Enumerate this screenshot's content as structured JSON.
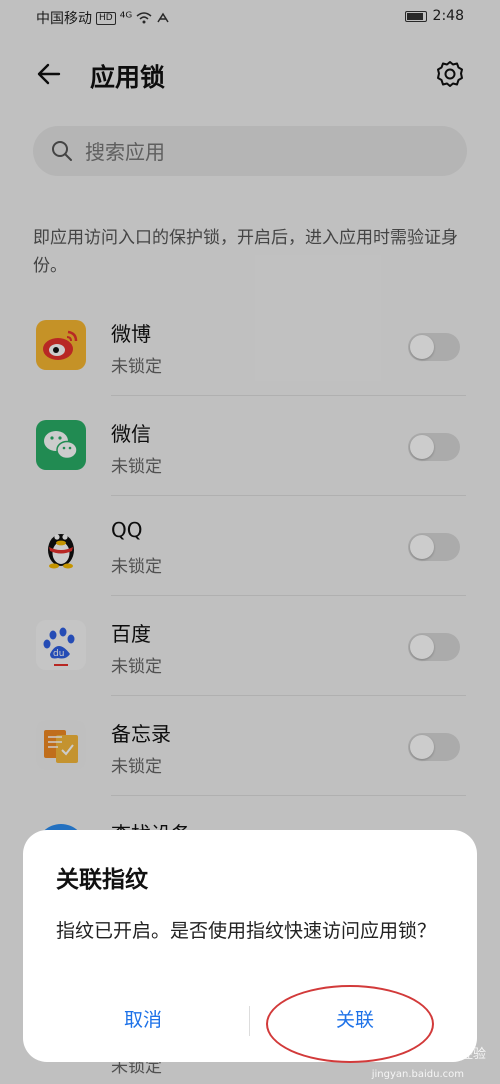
{
  "status_bar": {
    "carrier": "中国移动",
    "hd": "HD",
    "signal": "⁴ᴳ",
    "time": "2:48"
  },
  "header": {
    "title": "应用锁"
  },
  "search": {
    "placeholder": "搜索应用"
  },
  "description": "即应用访问入口的保护锁，开启后，进入应用时需验证身份。",
  "apps": [
    {
      "name": "微博",
      "status": "未锁定",
      "icon": "weibo-icon",
      "locked": false
    },
    {
      "name": "微信",
      "status": "未锁定",
      "icon": "wechat-icon",
      "locked": false
    },
    {
      "name": "QQ",
      "status": "未锁定",
      "icon": "qq-icon",
      "locked": false
    },
    {
      "name": "百度",
      "status": "未锁定",
      "icon": "baidu-icon",
      "locked": false
    },
    {
      "name": "备忘录",
      "status": "未锁定",
      "icon": "notepad-icon",
      "locked": false
    }
  ],
  "partial_app": {
    "name": "查找设备"
  },
  "below_status": "未锁定",
  "dialog": {
    "title": "关联指纹",
    "message": "指纹已开启。是否使用指纹快速访问应用锁？",
    "cancel_label": "取消",
    "confirm_label": "关联"
  },
  "watermark": {
    "brand": "Bai 经验",
    "url": "jingyan.baidu.com"
  },
  "colors": {
    "accent": "#1e72e8",
    "annotation": "#d23a3a"
  }
}
